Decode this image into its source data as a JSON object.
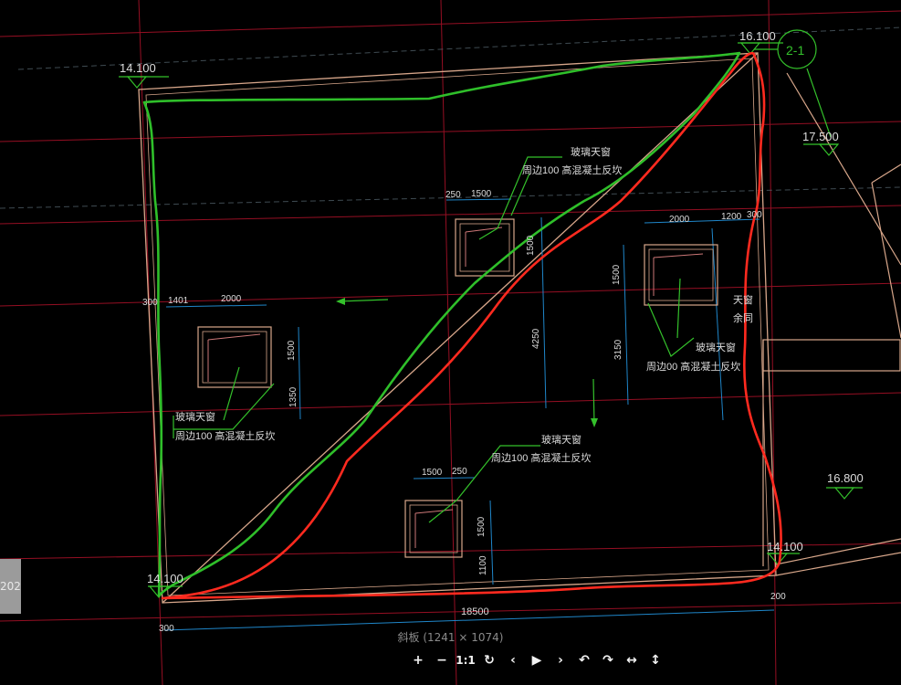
{
  "drawing": {
    "elevations": {
      "top_left": "14.100",
      "top_right": "16.100",
      "bottom_left": "14.100",
      "bottom_right": "14.100",
      "right_upper": "17.500",
      "right_mid": "16.800"
    },
    "section_marker": "2-1",
    "dimensions": {
      "left_300_top": "300",
      "left_1401": "1401",
      "left_2000": "2000",
      "left_1500": "1500",
      "left_1350": "1350",
      "top_250": "250",
      "top_1500": "1500",
      "mid_1500_v": "1500",
      "mid_4250": "4250",
      "right_2000": "2000",
      "right_1200": "1200",
      "right_300": "300",
      "right_1500": "1500",
      "right_3150": "3150",
      "bottom_1500": "1500",
      "bottom_250": "250",
      "bottom_1500_v": "1500",
      "bottom_1100": "1100",
      "total_18500": "18500",
      "bottom_left_300": "300",
      "bottom_right_200": "200"
    },
    "notes": {
      "skylight": "玻璃天窗",
      "curb": "周边100  高混凝土反坎",
      "curb_short": "周边00  高混凝土反坎",
      "skylight_right_a": "天窗",
      "skylight_right_b": "余同"
    }
  },
  "viewer": {
    "side_tab": "202",
    "caption": "斜板 (1241 × 1074)",
    "toolbar": {
      "zoom_in": "+",
      "zoom_out": "−",
      "actual_size": "1:1",
      "rotate": "↻",
      "prev": "‹",
      "play": "▶",
      "next": "›",
      "undo": "↶",
      "redo": "↷",
      "flip_h": "↔",
      "flip_v": "↕"
    }
  },
  "colors": {
    "background": "#000000",
    "green_outline": "#2fbf2a",
    "red_outline": "#ff2a1f",
    "grid_red": "#c4162b",
    "dimension_blue": "#1f86c9",
    "leader_green": "#34c12b",
    "slab_line": "#d7a68a"
  }
}
